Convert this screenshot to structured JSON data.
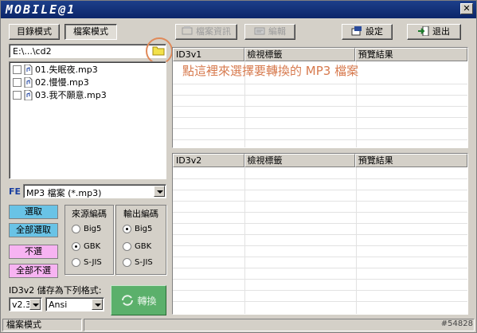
{
  "app": {
    "logo_text": "MOBILE@1",
    "close_glyph": "✕"
  },
  "toolbar": {
    "tab_directory": "目錄模式",
    "tab_file": "檔案模式",
    "file_info": "檔案資訊",
    "edit": "編輯",
    "settings": "設定",
    "exit": "退出"
  },
  "path": {
    "value": "E:\\...\\cd2"
  },
  "files": [
    {
      "name": "01.失眠夜.mp3",
      "checked": false
    },
    {
      "name": "02.慢慢.mp3",
      "checked": false
    },
    {
      "name": "03.我不願意.mp3",
      "checked": false
    }
  ],
  "filter": {
    "label": "FE",
    "value": "MP3 檔案 (*.mp3)"
  },
  "selection": {
    "select": "選取",
    "select_all": "全部選取",
    "deselect": "不選",
    "deselect_all": "全部不選"
  },
  "source_encoding": {
    "title": "來源編碼",
    "options": [
      "Big5",
      "GBK",
      "S-JIS"
    ],
    "selected": "GBK"
  },
  "output_encoding": {
    "title": "輸出編碼",
    "options": [
      "Big5",
      "GBK",
      "S-JIS"
    ],
    "selected": "Big5"
  },
  "id3v2_save": {
    "label": "ID3v2 儲存為下列格式:",
    "version": "v2.3",
    "encoding": "Ansi"
  },
  "convert_label": "轉換",
  "table_v1": {
    "columns": [
      "ID3v1",
      "檢視標籤",
      "預覽結果"
    ]
  },
  "table_v2": {
    "columns": [
      "ID3v2",
      "檢視標籤",
      "預覽結果"
    ]
  },
  "hint": "點這裡來選擇要轉換的 MP3 檔案",
  "status": {
    "mode": "檔案模式",
    "watermark": "#54828"
  },
  "colors": {
    "title_bar": "#0b2569",
    "hint": "#d77a4e",
    "select_btn": "#69c3e6",
    "deselect_btn": "#f7b3f2",
    "convert_btn": "#5bb06b"
  }
}
